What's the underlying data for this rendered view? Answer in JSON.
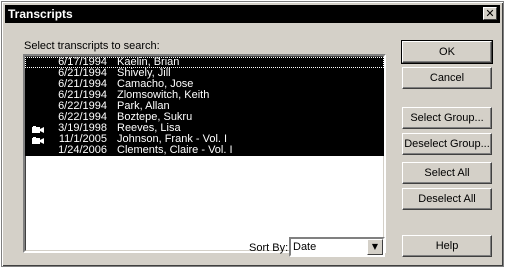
{
  "window": {
    "title": "Transcripts",
    "close_glyph": "✕"
  },
  "list": {
    "label": "Select transcripts to search:",
    "rows": [
      {
        "date": "6/17/1994",
        "name": "Kaelin, Brian",
        "icon": ""
      },
      {
        "date": "6/21/1994",
        "name": "Shively, Jill",
        "icon": ""
      },
      {
        "date": "6/21/1994",
        "name": "Camacho, Jose",
        "icon": ""
      },
      {
        "date": "6/21/1994",
        "name": "Zlomsowitch, Keith",
        "icon": ""
      },
      {
        "date": "6/22/1994",
        "name": "Park, Allan",
        "icon": ""
      },
      {
        "date": "6/22/1994",
        "name": "Boztepe, Sukru",
        "icon": ""
      },
      {
        "date": "3/19/1998",
        "name": "Reeves, Lisa",
        "icon": "camera-icon"
      },
      {
        "date": "11/1/2005",
        "name": "Johnson, Frank - Vol. I",
        "icon": "camera-icon"
      },
      {
        "date": "1/24/2006",
        "name": "Clements, Claire - Vol. I",
        "icon": ""
      }
    ]
  },
  "buttons": {
    "ok": "OK",
    "cancel": "Cancel",
    "select_group": "Select Group...",
    "deselect_group": "Deselect Group...",
    "select_all": "Select All",
    "deselect_all": "Deselect All",
    "help": "Help"
  },
  "sort": {
    "label": "Sort By:",
    "value": "Date",
    "arrow": "▼"
  },
  "colors": {
    "selection": "#000000",
    "dialog": "#d4d0c8"
  }
}
